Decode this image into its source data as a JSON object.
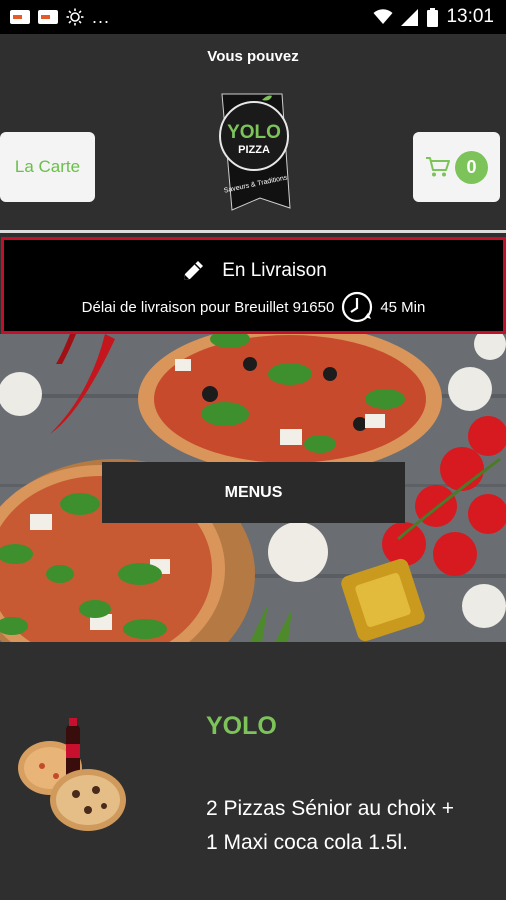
{
  "status_bar": {
    "time": "13:01",
    "overflow": "...",
    "icons": [
      "notification-icon",
      "notification-icon",
      "brightness-icon",
      "wifi-icon",
      "signal-icon",
      "battery-icon"
    ]
  },
  "header": {
    "message": "Vous pouvez",
    "carte_button": "La Carte",
    "cart_count": "0",
    "logo": {
      "brand": "YOLO",
      "sub": "PIZZA",
      "tagline": "Saveurs & Traditions"
    }
  },
  "delivery": {
    "mode": "En Livraison",
    "delay_text": "Délai de livraison pour Breuillet 91650",
    "delay_value": "45 Min",
    "border_color": "#c0102a"
  },
  "hero": {
    "menus_button": "MENUS"
  },
  "product": {
    "title": "YOLO",
    "description": "2 Pizzas Sénior au choix + 1 Maxi coca cola 1.5l."
  },
  "colors": {
    "accent_green": "#7cc35a",
    "background": "#2f2f2f"
  }
}
